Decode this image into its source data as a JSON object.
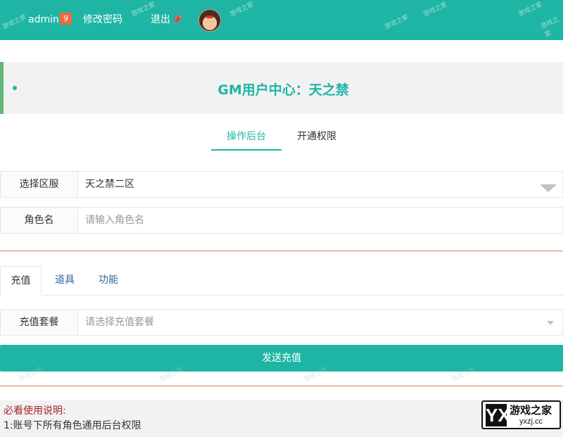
{
  "topbar": {
    "username": "admin",
    "badge_count": "9",
    "change_password": "修改密码",
    "logout": "退出",
    "logout_pin": "📌",
    "watermark": "游戏之家"
  },
  "hero": {
    "title": "GM用户中心：天之禁"
  },
  "main_tabs": [
    {
      "label": "操作后台",
      "active": true
    },
    {
      "label": "开通权限",
      "active": false
    }
  ],
  "server_select": {
    "label": "选择区服",
    "value": "天之禁二区"
  },
  "role_name": {
    "label": "角色名",
    "placeholder": "请输入角色名"
  },
  "sub_tabs": [
    {
      "label": "充值",
      "active": true
    },
    {
      "label": "道具",
      "active": false
    },
    {
      "label": "功能",
      "active": false
    }
  ],
  "recharge_package": {
    "label": "充值套餐",
    "placeholder": "请选择充值套餐"
  },
  "send_button": "发送充值",
  "notice": {
    "heading": "必看使用说明:",
    "line1": "1:账号下所有角色通用后台权限"
  },
  "site_logo": {
    "name_cn": "游戏之家",
    "domain": "yxzj.cc",
    "mark": "YX"
  },
  "colors": {
    "accent": "#1fb5a4",
    "hero_border": "#5fb878",
    "badge": "#ec6a3e",
    "notice_heading": "#a4262c",
    "separator": "#d9826a"
  }
}
